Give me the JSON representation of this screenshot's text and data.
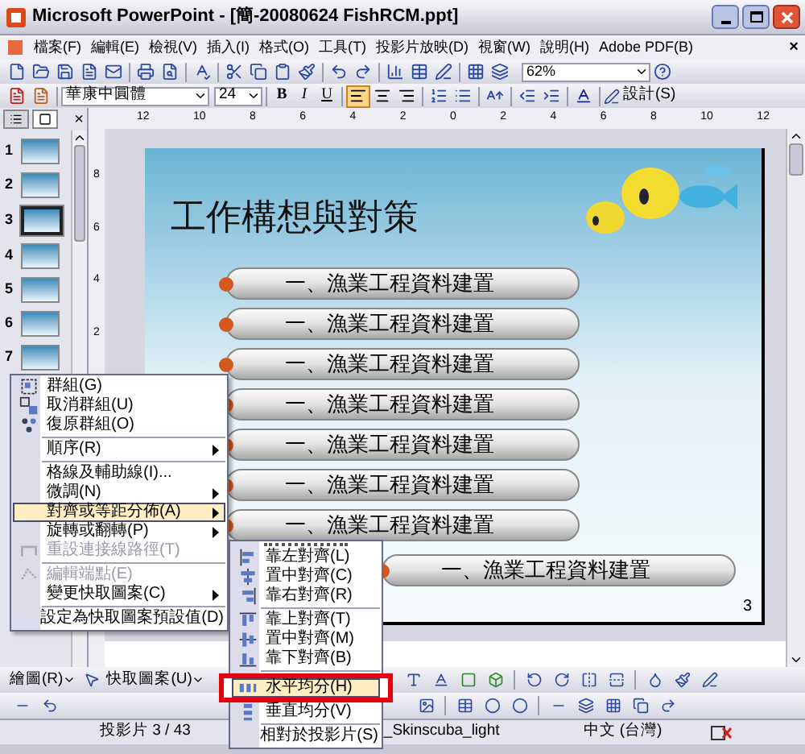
{
  "window": {
    "title": "Microsoft PowerPoint - [簡-20080624 FishRCM.ppt]"
  },
  "menu_bar": {
    "items": [
      "檔案(F)",
      "編輯(E)",
      "檢視(V)",
      "插入(I)",
      "格式(O)",
      "工具(T)",
      "投影片放映(D)",
      "視窗(W)",
      "說明(H)",
      "Adobe PDF(B)"
    ],
    "close": "×"
  },
  "standard_toolbar": {
    "zoom": "62%"
  },
  "formatting_toolbar": {
    "font": "華康中圓體",
    "size": "24",
    "bold": "B",
    "italic": "I",
    "underline": "U",
    "alignment": [
      {
        "selected": true
      },
      {
        "selected": false
      },
      {
        "selected": false
      }
    ],
    "design": "設計(S)"
  },
  "ruler": [
    "12",
    "10",
    "8",
    "6",
    "4",
    "2",
    "0",
    "2",
    "4",
    "6",
    "8",
    "10",
    "12"
  ],
  "vertical_ruler": [
    "8",
    "6",
    "4",
    "2"
  ],
  "slides_panel": {
    "close": "×",
    "thumbnails": [
      {
        "number": "1",
        "selected": false
      },
      {
        "number": "2",
        "selected": false
      },
      {
        "number": "3",
        "selected": true
      },
      {
        "number": "4",
        "selected": false
      },
      {
        "number": "5",
        "selected": false
      },
      {
        "number": "6",
        "selected": false
      },
      {
        "number": "7",
        "selected": false
      }
    ]
  },
  "slide": {
    "title": "工作構想與對策",
    "page_number": "3",
    "shapes": [
      {
        "text": "一、漁業工程資料建置"
      },
      {
        "text": "一、漁業工程資料建置"
      },
      {
        "text": "一、漁業工程資料建置"
      },
      {
        "text": "一、漁業工程資料建置"
      },
      {
        "text": "一、漁業工程資料建置"
      },
      {
        "text": "一、漁業工程資料建置"
      },
      {
        "text": "一、漁業工程資料建置"
      },
      {
        "text": "一、漁業工程資料建置"
      }
    ]
  },
  "context_menu": {
    "items": [
      {
        "kind": "command",
        "label": "群組(G)",
        "disabled": false,
        "selected": false
      },
      {
        "kind": "command",
        "label": "取消群組(U)",
        "disabled": false,
        "selected": false
      },
      {
        "kind": "command",
        "label": "復原群組(O)",
        "disabled": false,
        "selected": false
      },
      {
        "kind": "separator"
      },
      {
        "kind": "submenu",
        "label": "順序(R)",
        "disabled": false,
        "selected": false
      },
      {
        "kind": "separator"
      },
      {
        "kind": "command",
        "label": "格線及輔助線(I)...",
        "disabled": false,
        "selected": false
      },
      {
        "kind": "submenu",
        "label": "微調(N)",
        "disabled": false,
        "selected": false
      },
      {
        "kind": "submenu",
        "label": "對齊或等距分佈(A)",
        "disabled": false,
        "selected": true
      },
      {
        "kind": "submenu",
        "label": "旋轉或翻轉(P)",
        "disabled": false,
        "selected": false
      },
      {
        "kind": "command",
        "label": "重設連接線路徑(T)",
        "disabled": true,
        "selected": false
      },
      {
        "kind": "separator"
      },
      {
        "kind": "command",
        "label": "編輯端點(E)",
        "disabled": true,
        "selected": false
      },
      {
        "kind": "submenu",
        "label": "變更快取圖案(C)",
        "disabled": false,
        "selected": false
      },
      {
        "kind": "separator"
      },
      {
        "kind": "command",
        "label": "設定為快取圖案預設值(D)",
        "disabled": false,
        "selected": false
      }
    ]
  },
  "align_submenu": {
    "items": [
      {
        "kind": "command",
        "label": "靠左對齊(L)",
        "selected": false
      },
      {
        "kind": "command",
        "label": "置中對齊(C)",
        "selected": false
      },
      {
        "kind": "command",
        "label": "靠右對齊(R)",
        "selected": false
      },
      {
        "kind": "separator"
      },
      {
        "kind": "command",
        "label": "靠上對齊(T)",
        "selected": false
      },
      {
        "kind": "command",
        "label": "置中對齊(M)",
        "selected": false
      },
      {
        "kind": "command",
        "label": "靠下對齊(B)",
        "selected": false
      },
      {
        "kind": "separator"
      },
      {
        "kind": "command",
        "label": "水平均分(H)",
        "selected": true
      },
      {
        "kind": "command",
        "label": "垂直均分(V)",
        "selected": false
      },
      {
        "kind": "separator"
      },
      {
        "kind": "command",
        "label": "相對於投影片(S)",
        "selected": false
      }
    ]
  },
  "drawing_toolbar": {
    "draw": "繪圖(R)",
    "autoshapes": "快取圖案(U)"
  },
  "status_bar": {
    "slide": "投影片 3 / 43",
    "design": "_Skinscuba_light",
    "language": "中文 (台灣)"
  }
}
